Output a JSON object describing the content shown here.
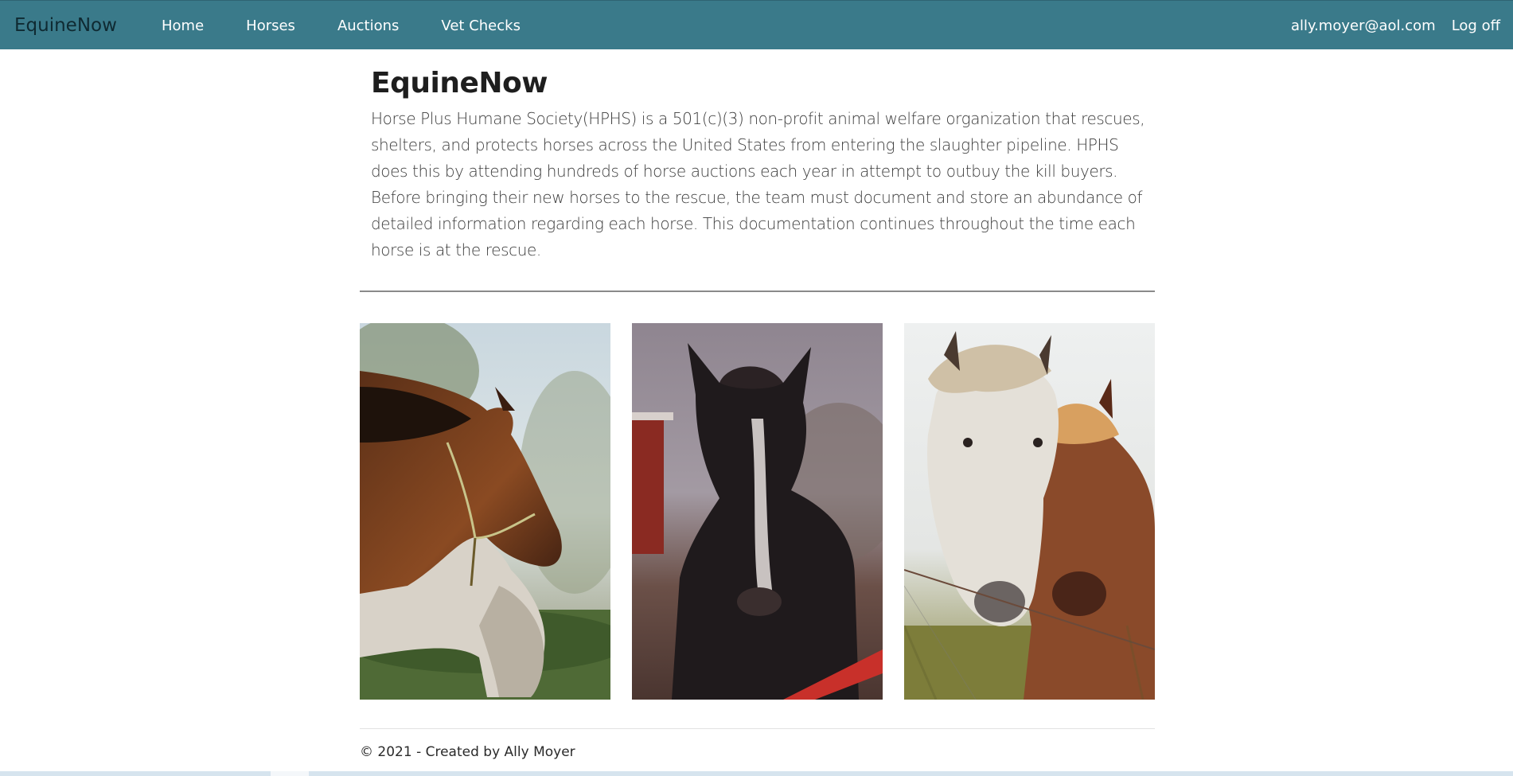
{
  "navbar": {
    "brand": "EquineNow",
    "links": [
      {
        "label": "Home"
      },
      {
        "label": "Horses"
      },
      {
        "label": "Auctions"
      },
      {
        "label": "Vet Checks"
      }
    ],
    "user_email": "ally.moyer@aol.com",
    "logoff_label": "Log off",
    "color": "#3a7a8a"
  },
  "main": {
    "title": "EquineNow",
    "description": "Horse Plus Humane Society(HPHS) is a 501(c)(3) non-profit animal welfare organization that rescues, shelters, and protects horses across the United States from entering the slaughter pipeline. HPHS does this by attending hundreds of horse auctions each year in attempt to outbuy the kill buyers. Before bringing their new horses to the rescue, the team must document and store an abundance of detailed information regarding each horse. This documentation continues throughout the time each horse is at the rescue."
  },
  "gallery": {
    "photos": [
      {
        "subject": "bay horse with halter and grazing grey horse"
      },
      {
        "subject": "dark horse with white blaze"
      },
      {
        "subject": "white horse and chestnut pony behind wire fence"
      }
    ]
  },
  "footer": {
    "text": "© 2021 - Created by Ally Moyer"
  }
}
